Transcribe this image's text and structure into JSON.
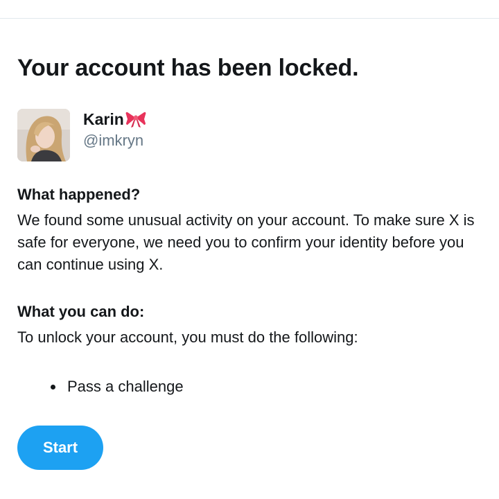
{
  "page": {
    "title": "Your account has been locked."
  },
  "profile": {
    "display_name": "Karin",
    "name_emoji_icon": "ribbon-bow-icon",
    "handle": "@imkryn"
  },
  "what_happened": {
    "heading": "What happened?",
    "text": "We found some unusual activity on your account. To make sure X is safe for everyone, we need you to confirm your identity before you can continue using X."
  },
  "what_you_can_do": {
    "heading": "What you can do:",
    "text": "To unlock your account, you must do the following:",
    "steps": [
      "Pass a challenge"
    ]
  },
  "actions": {
    "start_label": "Start"
  },
  "colors": {
    "accent": "#1da1f2",
    "text_primary": "#14171a",
    "text_secondary": "#657786",
    "divider": "#e1e8ed"
  }
}
